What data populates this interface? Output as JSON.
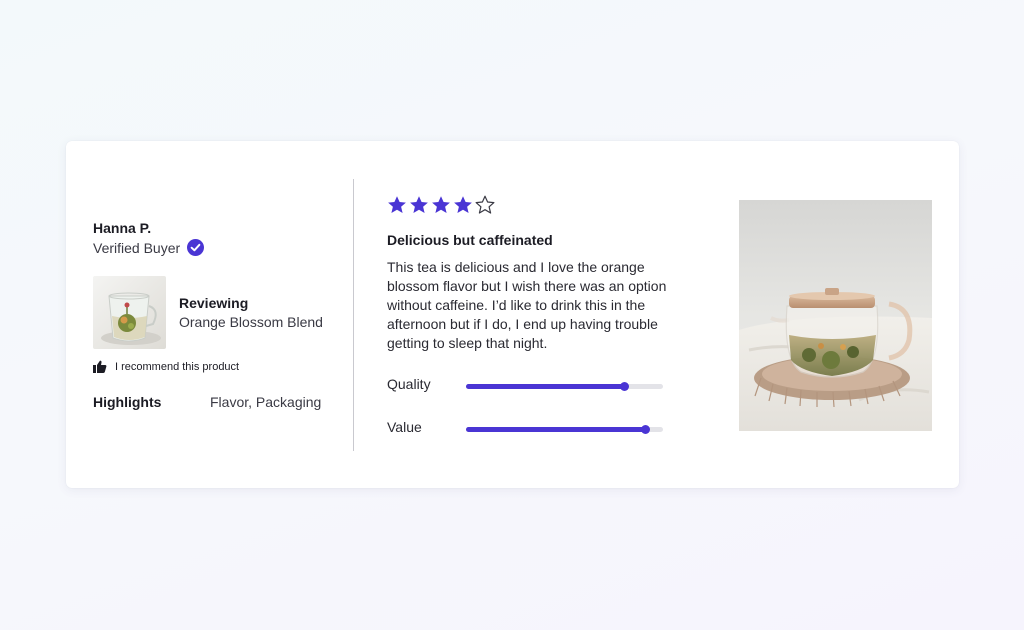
{
  "colors": {
    "accent": "#4a35d4",
    "track": "#e3e3e8",
    "divider": "#c9c9cf"
  },
  "reviewer": {
    "name": "Hanna P.",
    "badge_text": "Verified Buyer",
    "badge_icon": "verified-check-icon"
  },
  "product": {
    "reviewing_label": "Reviewing",
    "name": "Orange Blossom Blend",
    "thumbnail": "tea-cup-thumbnail"
  },
  "recommendation": {
    "icon": "thumbs-up-icon",
    "text": "I recommend this product"
  },
  "highlights": {
    "label": "Highlights",
    "value": "Flavor, Packaging"
  },
  "review": {
    "rating": 4,
    "max_rating": 5,
    "title": "Delicious but caffeinated",
    "body": "This tea is delicious and I love the orange blossom flavor but I wish there was an option without caffeine. I’d like to drink this in the afternoon but if I do, I end up having trouble getting to sleep that night."
  },
  "ratings": [
    {
      "label": "Quality",
      "value": 0.8
    },
    {
      "label": "Value",
      "value": 0.91
    }
  ],
  "photo": {
    "subject": "glass-teapot-photo"
  }
}
